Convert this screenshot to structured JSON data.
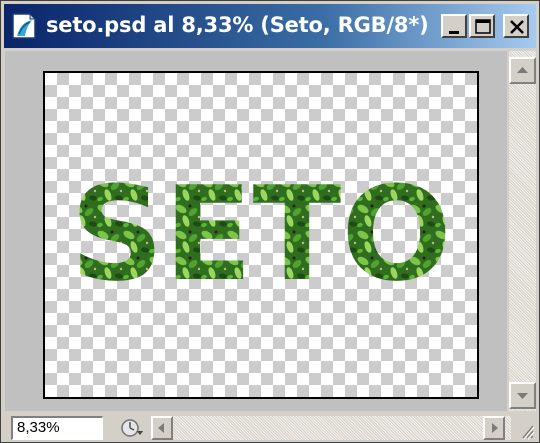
{
  "window": {
    "title": "seto.psd al 8,33% (Seto, RGB/8*)",
    "app_icon": "photoshop-document-icon",
    "controls": {
      "minimize": "minimize-icon",
      "maximize": "maximize-icon",
      "close": "close-icon"
    }
  },
  "document": {
    "artwork_text": "SETO",
    "background": "transparency-checkerboard",
    "fill": "leaf-texture"
  },
  "statusbar": {
    "zoom_value": "8,33%",
    "status_menu_icon": "status-menu-icon"
  },
  "colors": {
    "titlebar_start": "#0a246a",
    "titlebar_end": "#a6caf0",
    "chrome": "#d4d0c8",
    "canvas_gray": "#c0c0c0",
    "leaf_green": "#3f8a2a"
  }
}
